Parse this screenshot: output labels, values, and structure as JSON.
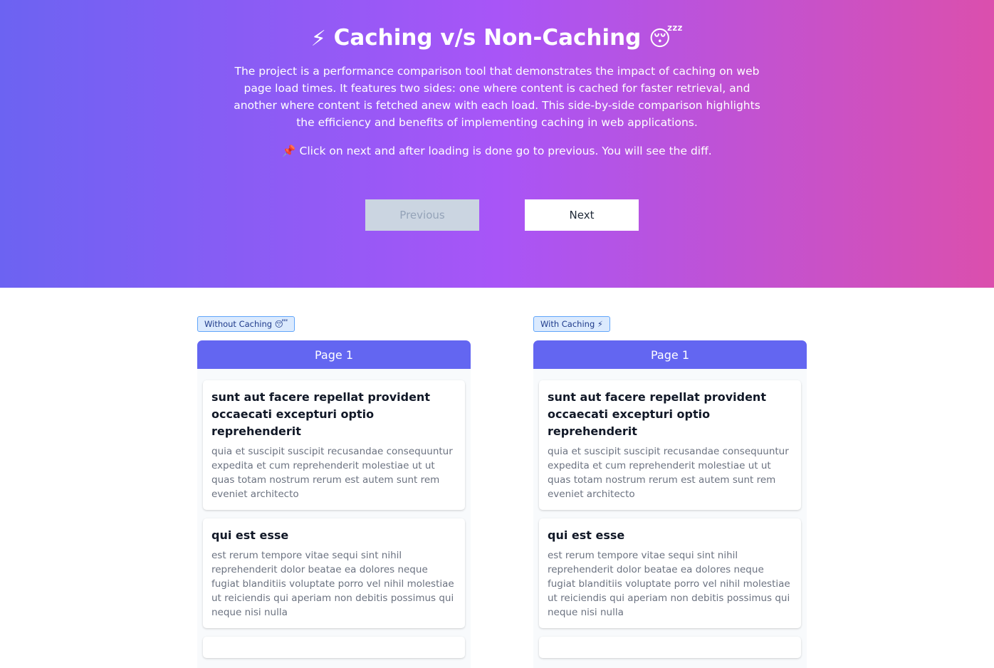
{
  "header": {
    "title": "Caching v/s Non-Caching",
    "title_icon_left": "⚡",
    "title_icon_right": "😴",
    "description": "The project is a performance comparison tool that demonstrates the impact of caching on web page load times. It features two sides: one where content is cached for faster retrieval, and another where content is fetched anew with each load. This side-by-side comparison highlights the efficiency and benefits of implementing caching in web applications.",
    "hint_icon": "📌",
    "hint": "Click on next and after loading is done go to previous. You will see the diff."
  },
  "pagination": {
    "previous_label": "Previous",
    "next_label": "Next",
    "previous_disabled": true
  },
  "columns": [
    {
      "tag": "Without Caching 😴",
      "page_label": "Page 1",
      "posts": [
        {
          "title": "sunt aut facere repellat provident occaecati excepturi optio reprehenderit",
          "body": "quia et suscipit suscipit recusandae consequuntur expedita et cum reprehenderit molestiae ut ut quas totam nostrum rerum est autem sunt rem eveniet architecto"
        },
        {
          "title": "qui est esse",
          "body": "est rerum tempore vitae sequi sint nihil reprehenderit dolor beatae ea dolores neque fugiat blanditiis voluptate porro vel nihil molestiae ut reiciendis qui aperiam non debitis possimus qui neque nisi nulla"
        }
      ]
    },
    {
      "tag": "With Caching ⚡",
      "page_label": "Page 1",
      "posts": [
        {
          "title": "sunt aut facere repellat provident occaecati excepturi optio reprehenderit",
          "body": "quia et suscipit suscipit recusandae consequuntur expedita et cum reprehenderit molestiae ut ut quas totam nostrum rerum est autem sunt rem eveniet architecto"
        },
        {
          "title": "qui est esse",
          "body": "est rerum tempore vitae sequi sint nihil reprehenderit dolor beatae ea dolores neque fugiat blanditiis voluptate porro vel nihil molestiae ut reiciendis qui aperiam non debitis possimus qui neque nisi nulla"
        }
      ]
    }
  ],
  "colors": {
    "gradient_start": "#6c63f2",
    "gradient_mid": "#a855f7",
    "gradient_end": "#db4fad",
    "page_header": "#6366f1",
    "tag_bg": "#dbeafe",
    "tag_border": "#60a5fa"
  }
}
